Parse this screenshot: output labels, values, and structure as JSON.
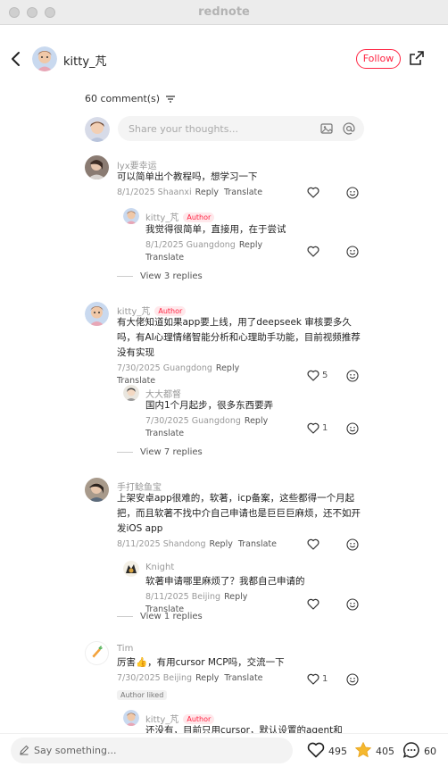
{
  "window": {
    "title": "rednote"
  },
  "header": {
    "username": "kitty_芃",
    "follow_label": "Follow"
  },
  "comments_header": {
    "count_label": "60 comment(s)"
  },
  "composer": {
    "placeholder": "Share your thoughts..."
  },
  "comments": [
    {
      "user": "lyx要幸运",
      "text": "可以简单出个教程吗，想学习一下",
      "date_location": "8/1/2025 Shaanxi",
      "reply_label": "Reply",
      "translate_label": "Translate",
      "reply": {
        "user": "kitty_芃",
        "badge": "Author",
        "text": "我觉得很简单，直接用，在于尝试",
        "date_location": "8/1/2025 Guangdong",
        "reply_label": "Reply",
        "translate_label": "Translate"
      },
      "view_replies": "View 3 replies"
    },
    {
      "user": "kitty_芃",
      "badge": "Author",
      "text": "有大佬知道如果app要上线，用了deepseek 审核要多久吗，有AI心理情绪智能分析和心理助手功能，目前视频推荐没有实现",
      "date_location": "7/30/2025 Guangdong",
      "reply_label": "Reply",
      "translate_label": "Translate",
      "like_count": "5",
      "reply": {
        "user": "大大都督",
        "text": "国内1个月起步，很多东西要弄",
        "date_location": "7/30/2025 Guangdong",
        "reply_label": "Reply",
        "translate_label": "Translate",
        "like_count": "1"
      },
      "view_replies": "View 7 replies"
    },
    {
      "user": "手打鲶鱼宝",
      "text": "上架安卓app很难的，软著，icp备案，这些都得一个月起把，而且软著不找中介自己申请也是巨巨巨麻烦，还不如开发iOS app",
      "date_location": "8/11/2025 Shandong",
      "reply_label": "Reply",
      "translate_label": "Translate",
      "reply": {
        "user": "Knight",
        "text": "软著申请哪里麻烦了？我都自己申请的",
        "date_location": "8/11/2025 Beijing",
        "reply_label": "Reply",
        "translate_label": "Translate"
      },
      "view_replies": "View 1 replies"
    },
    {
      "user": "Tim",
      "text": "厉害👍，有用cursor MCP吗，交流一下",
      "date_location": "7/30/2025 Beijing",
      "reply_label": "Reply",
      "translate_label": "Translate",
      "like_count": "1",
      "author_liked": "Author liked",
      "reply": {
        "user": "kitty_芃",
        "badge": "Author",
        "text": "还没有，目前只用cursor，默认设置的agent和"
      }
    }
  ],
  "bottom_bar": {
    "placeholder": "Say something...",
    "likes": "495",
    "stars": "405",
    "comments": "60"
  },
  "colors": {
    "accent": "#ff2442",
    "star": "#f5b82e"
  }
}
